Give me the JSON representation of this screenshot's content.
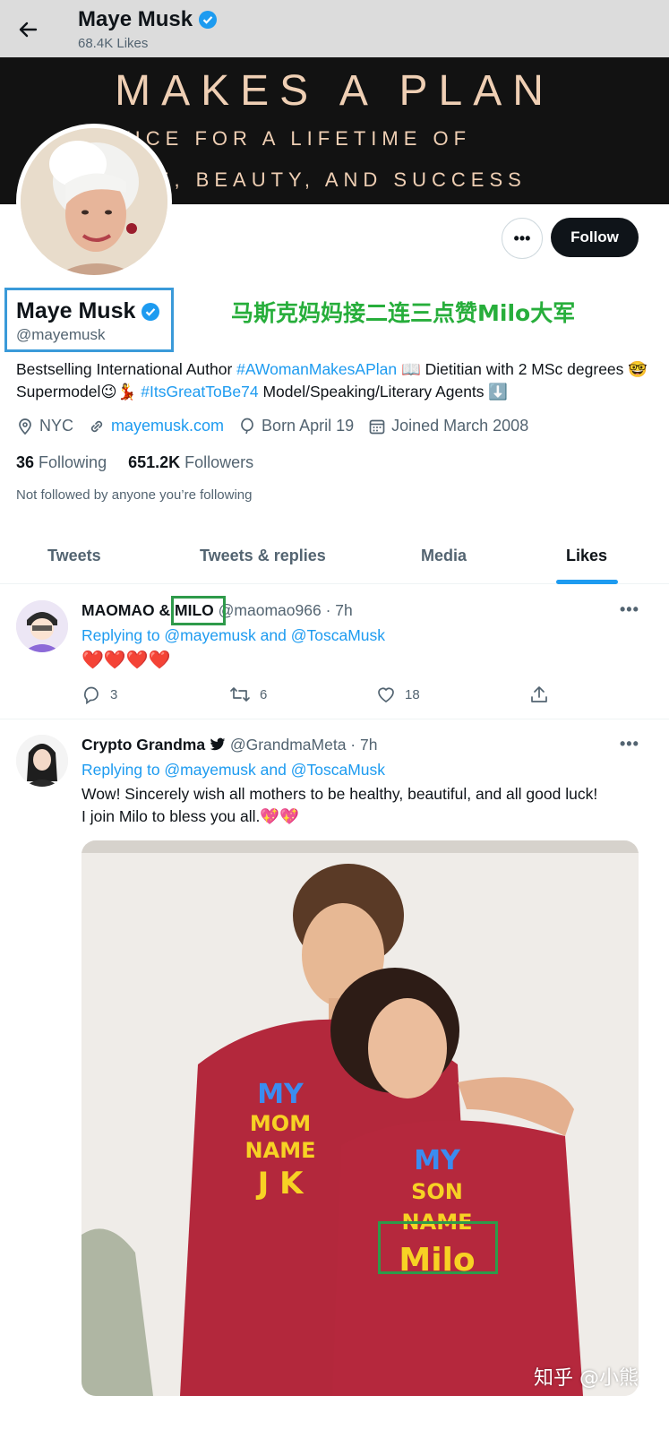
{
  "header": {
    "name": "Maye Musk",
    "likes_count": "68.4K Likes"
  },
  "banner": {
    "line1": "MAKES A PLAN",
    "line2": "VICE FOR A LIFETIME OF",
    "line3": "URE, BEAUTY, AND SUCCESS"
  },
  "profile": {
    "name": "Maye Musk",
    "handle": "@mayemusk",
    "more_label": "•••",
    "follow_label": "Follow",
    "annotation": "马斯克妈妈接二连三点赞Milo大军",
    "bio_part1": "Bestselling International Author ",
    "bio_tag1": "#AWomanMakesAPlan",
    "bio_part2": " 📖 Dietitian with 2 MSc degrees 🤓 Supermodel😉💃 ",
    "bio_tag2": "#ItsGreatToBe74",
    "bio_part3": " Model/Speaking/Literary Agents ⬇️",
    "location": "NYC",
    "website": "mayemusk.com",
    "birthday": "Born April 19",
    "joined": "Joined March 2008",
    "following_count": "36",
    "following_label": "Following",
    "followers_count": "651.2K",
    "followers_label": "Followers",
    "not_followed": "Not followed by anyone you’re following"
  },
  "tabs": [
    "Tweets",
    "Tweets & replies",
    "Media",
    "Likes"
  ],
  "active_tab": "Likes",
  "tweets": [
    {
      "name_part1": "MAOMAO & ",
      "name_part2": "MILO",
      "handle_time": "@maomao966 · 7h",
      "replying_prefix": "Replying to ",
      "replying_to": "@mayemusk and @ToscaMusk",
      "text": "❤️❤️❤️❤️",
      "replies": "3",
      "retweets": "6",
      "likes": "18"
    },
    {
      "name": "Crypto Grandma",
      "handle_time": "@GrandmaMeta · 7h",
      "replying_prefix": "Replying to ",
      "replying_to": "@mayemusk and @ToscaMusk",
      "text_line1": "Wow!  Sincerely wish all mothers to be healthy, beautiful, and all good luck!",
      "text_line2": "I join Milo to bless you all.💖💖"
    }
  ],
  "photo": {
    "shirt_left_line1": "MY",
    "shirt_left_line2": "MOM NAME",
    "shirt_left_line3": "J K",
    "shirt_right_line1": "MY",
    "shirt_right_line2": "SON NAME",
    "shirt_right_line3": "Milo"
  },
  "watermark": "知乎 @小熊",
  "colors": {
    "accent": "#1d9bf0",
    "annotation_green": "#27ae3b",
    "box_blue": "#3a9ad9",
    "box_green": "#2e9a4a",
    "shirt_red": "#b3283c"
  }
}
